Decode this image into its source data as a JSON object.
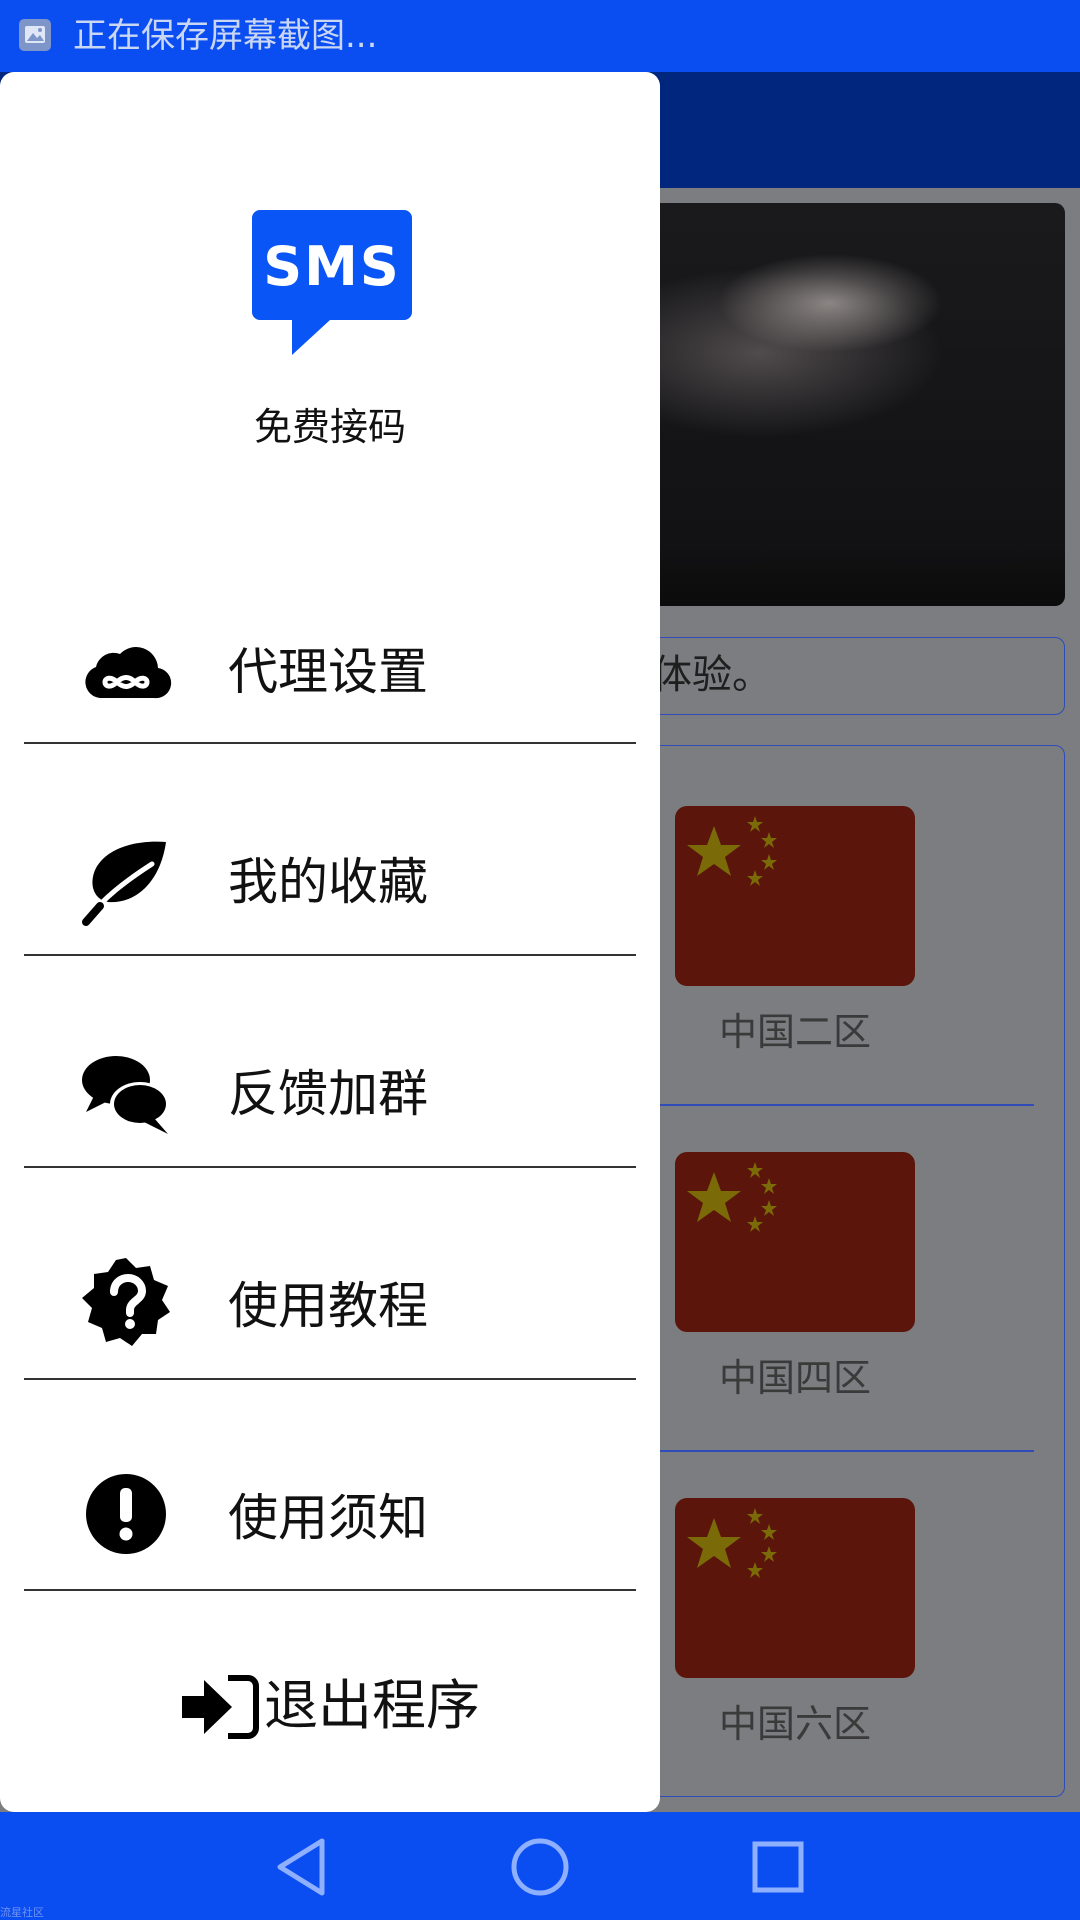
{
  "status_bar": {
    "notification_icon": "image-icon",
    "text": "正在保存屏幕截图..."
  },
  "background": {
    "notice_text": "体验。",
    "regions": [
      {
        "label": "中国二区",
        "flag": "china-flag"
      },
      {
        "label": "中国四区",
        "flag": "china-flag"
      },
      {
        "label": "中国六区",
        "flag": "china-flag"
      }
    ]
  },
  "drawer": {
    "logo_text": "SMS",
    "app_name": "免费接码",
    "menu": [
      {
        "label": "代理设置",
        "icon": "cloud-infinity-icon"
      },
      {
        "label": "我的收藏",
        "icon": "leaf-icon"
      },
      {
        "label": "反馈加群",
        "icon": "chat-bubbles-icon"
      },
      {
        "label": "使用教程",
        "icon": "question-badge-icon"
      },
      {
        "label": "使用须知",
        "icon": "exclamation-icon"
      }
    ],
    "exit_label": "退出程序",
    "exit_icon": "sign-in-arrow-icon"
  },
  "nav_bar": {
    "buttons": [
      "back-icon",
      "home-icon",
      "recents-icon"
    ],
    "watermark": "流星社区"
  },
  "colors": {
    "system_blue": "#0a4ef2",
    "header_dark_blue": "#01267e",
    "logo_blue": "#0a55f5",
    "flag_red": "#5b150b",
    "flag_star": "#7a6a08"
  }
}
